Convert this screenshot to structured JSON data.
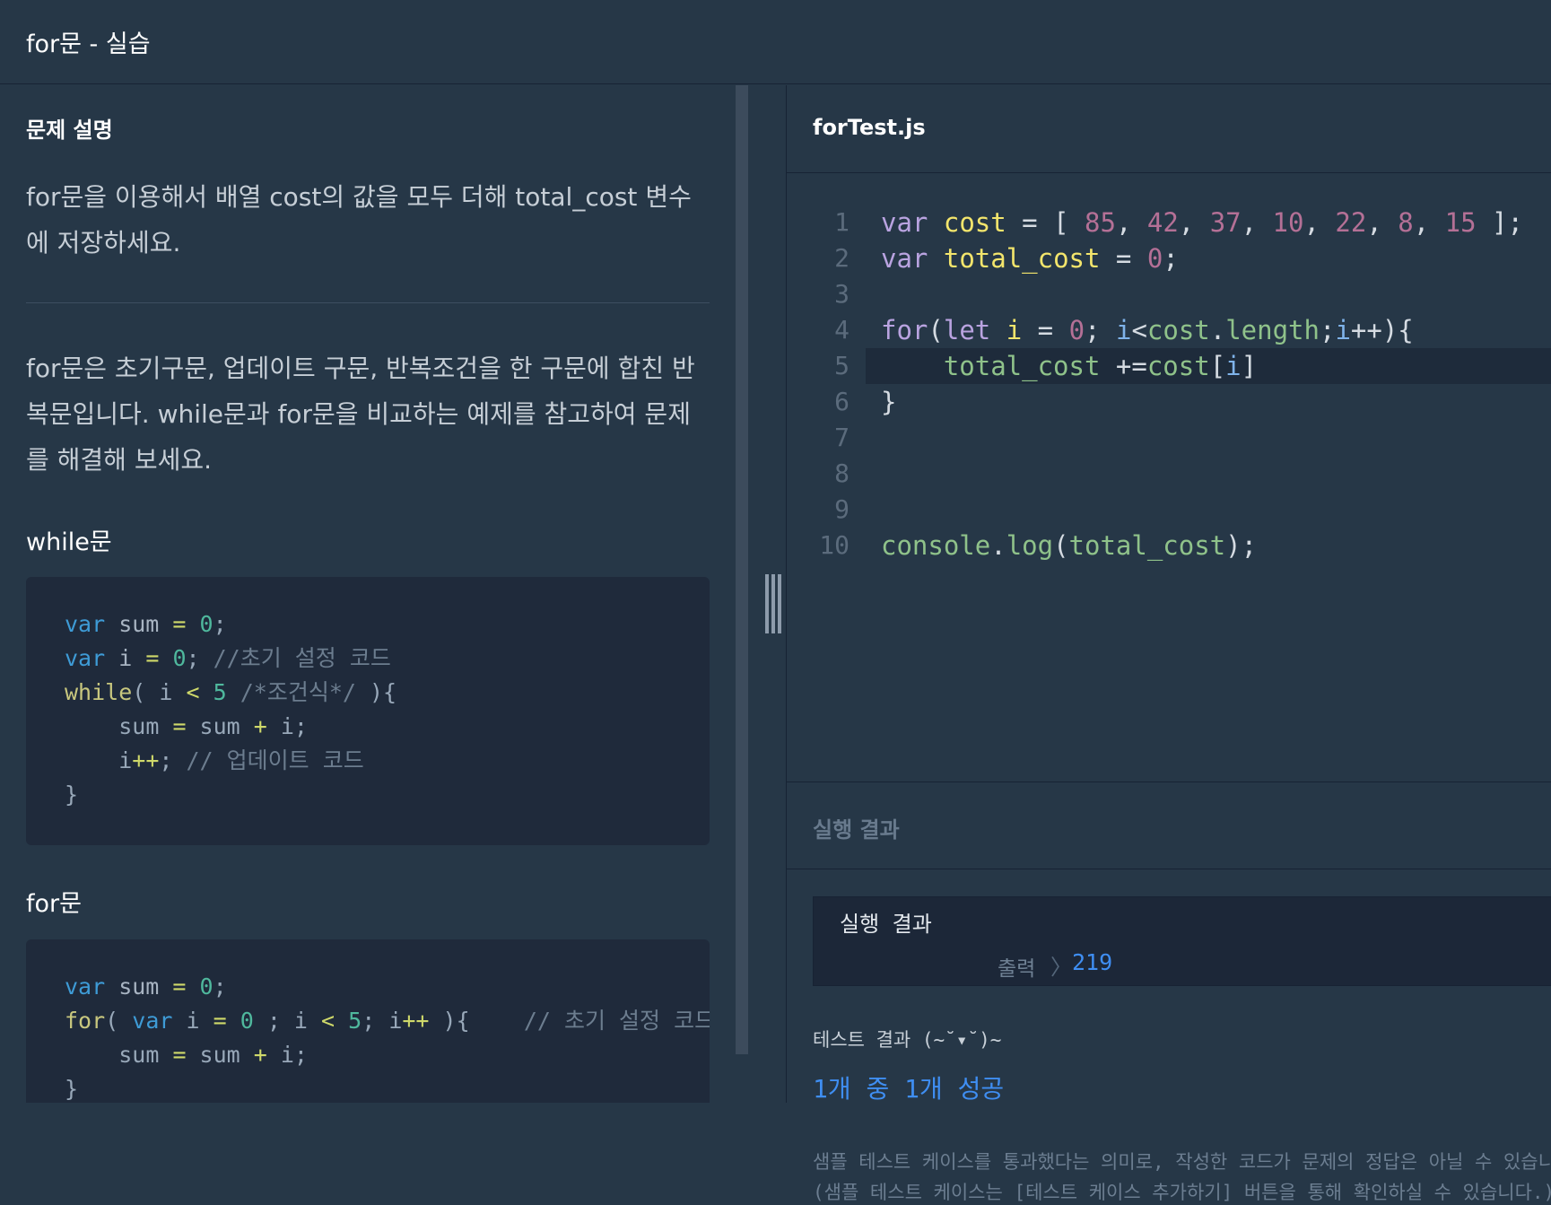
{
  "header": {
    "title": "for문 - 실습"
  },
  "description": {
    "section_title": "문제 설명",
    "paragraph1_line1": "for문을 이용해서 배열 cost의 값을 모두 더해 total_cost 변수",
    "paragraph1_line2": "에 저장하세요.",
    "paragraph2_line1": "for문은 초기구문, 업데이트 구문, 반복조건을 한 구문에 합친 반",
    "paragraph2_line2": "복문입니다. while문과 for문을 비교하는 예제를 참고하여 문제",
    "paragraph2_line3": "를 해결해 보세요.",
    "while_title": "while문",
    "for_title": "for문"
  },
  "while_example": {
    "l1_kw": "var",
    "l1_name": " sum ",
    "l1_op": "=",
    "l1_sp": " ",
    "l1_num": "0",
    "l1_end": ";",
    "l2_kw": "var",
    "l2_name": " i ",
    "l2_op": "=",
    "l2_sp": " ",
    "l2_num": "0",
    "l2_end": "; ",
    "l2_cm": "//초기 설정 코드",
    "l3_fn": "while",
    "l3_a": "( i ",
    "l3_op": "<",
    "l3_sp": " ",
    "l3_num": "5",
    "l3_sp2": " ",
    "l3_cm": "/*조건식*/",
    "l3_end": " ){",
    "l4_indent": "    ",
    "l4_a": "sum ",
    "l4_op": "=",
    "l4_b": " sum ",
    "l4_op2": "+",
    "l4_c": " i;",
    "l5_indent": "    ",
    "l5_a": "i",
    "l5_op": "++",
    "l5_b": "; ",
    "l5_cm": "// 업데이트 코드",
    "l6": "}"
  },
  "for_example": {
    "l1_kw": "var",
    "l1_name": " sum ",
    "l1_op": "=",
    "l1_sp": " ",
    "l1_num": "0",
    "l1_end": ";",
    "l2_fn": "for",
    "l2_a": "( ",
    "l2_kw": "var",
    "l2_b": " i ",
    "l2_op": "=",
    "l2_sp": " ",
    "l2_num": "0",
    "l2_c": " ; i ",
    "l2_op2": "<",
    "l2_sp2": " ",
    "l2_num2": "5",
    "l2_d": "; i",
    "l2_op3": "++",
    "l2_e": " ){    ",
    "l2_cm": "// 초기 설정 코드",
    "l3_indent": "    ",
    "l3_a": "sum ",
    "l3_op": "=",
    "l3_b": " sum ",
    "l3_op2": "+",
    "l3_c": " i;",
    "l4": "}"
  },
  "editor": {
    "file_name": "forTest.js",
    "line_numbers": [
      "1",
      "2",
      "3",
      "4",
      "5",
      "6",
      "7",
      "8",
      "9",
      "10"
    ],
    "l1": {
      "kw": "var",
      "sp": " ",
      "var": "cost",
      "eq": " = [ ",
      "n1": "85",
      "c1": ", ",
      "n2": "42",
      "c2": ", ",
      "n3": "37",
      "c3": ", ",
      "n4": "10",
      "c4": ", ",
      "n5": "22",
      "c5": ", ",
      "n6": "8",
      "c6": ", ",
      "n7": "15",
      "end": " ];"
    },
    "l2": {
      "kw": "var",
      "sp": " ",
      "var": "total_cost",
      "eq": " = ",
      "num": "0",
      "end": ";"
    },
    "l4": {
      "kw": "for",
      "p1": "(",
      "kw2": "let",
      "sp": " ",
      "var": "i",
      "eq": " = ",
      "num": "0",
      "semi": "; ",
      "id": "i",
      "lt": "<",
      "prop": "cost",
      "dot": ".",
      "prop2": "length",
      "semi2": ";",
      "id2": "i",
      "end": "++){"
    },
    "l5": {
      "indent": "    ",
      "prop": "total_cost",
      "op": " +=",
      "prop2": "cost",
      "br": "[",
      "id": "i",
      "br2": "]"
    },
    "l6": {
      "text": "}"
    },
    "l10": {
      "prop": "console",
      "dot": ".",
      "prop2": "log",
      "p1": "(",
      "prop3": "total_cost",
      "end": ");"
    }
  },
  "result": {
    "section_label": "실행 결과",
    "box_title": "실행 결과",
    "output_label": "출력",
    "output_arrow": "〉",
    "output_value": "219",
    "test_title": "테스트 결과 (~˘▾˘)~",
    "test_pass": "1개 중 1개 성공",
    "note_line1": "샘플 테스트 케이스를 통과했다는 의미로, 작성한 코드가 문제의 정답은 아닐 수 있습니다.",
    "note_line2": "(샘플 테스트 케이스는 [테스트 케이스 추가하기] 버튼을 통해 확인하실 수 있습니다.)"
  },
  "colors": {
    "background": "#263747",
    "code_block": "#1f2a3b",
    "accent_blue": "#3f8ef2"
  }
}
